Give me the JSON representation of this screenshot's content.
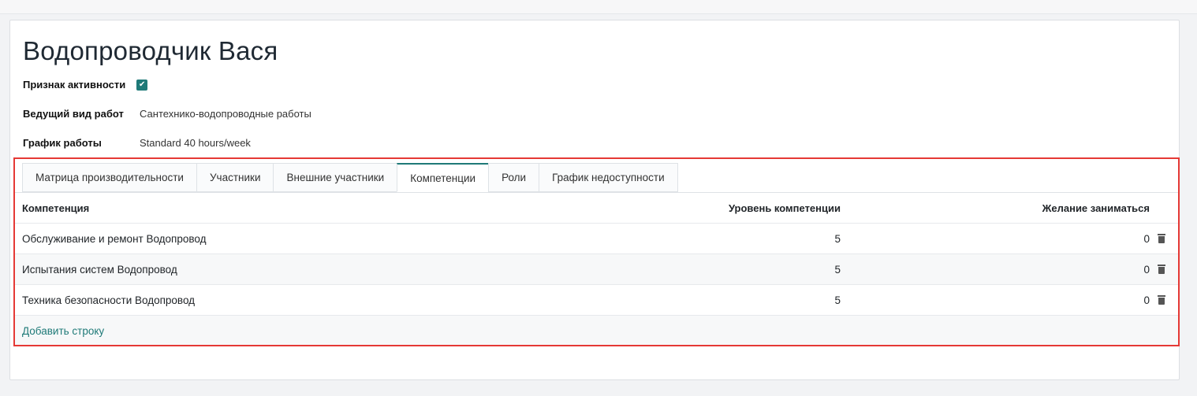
{
  "record": {
    "title": "Водопроводчик Вася",
    "fields": [
      {
        "label": "Признак активности",
        "checked": true
      },
      {
        "label": "Ведущий вид работ",
        "value": "Сантехнико-водопроводные работы"
      },
      {
        "label": "График работы",
        "value": "Standard 40 hours/week"
      }
    ]
  },
  "tabs": [
    {
      "label": "Матрица производительности"
    },
    {
      "label": "Участники"
    },
    {
      "label": "Внешние участники"
    },
    {
      "label": "Компетенции",
      "active": true
    },
    {
      "label": "Роли"
    },
    {
      "label": "График недоступности"
    }
  ],
  "table": {
    "columns": [
      "Компетенция",
      "Уровень компетенции",
      "Желание заниматься"
    ],
    "rows": [
      {
        "name": "Обслуживание и ремонт Водопровод",
        "level": "5",
        "wish": "0"
      },
      {
        "name": "Испытания систем Водопровод",
        "level": "5",
        "wish": "0"
      },
      {
        "name": "Техника безопасности Водопровод",
        "level": "5",
        "wish": "0"
      }
    ],
    "add_row_label": "Добавить строку"
  },
  "colors": {
    "accent": "#1f7a78",
    "highlight_frame": "#e53935"
  },
  "icons": {
    "checkbox": "checkmark-icon",
    "delete": "trash-icon"
  }
}
